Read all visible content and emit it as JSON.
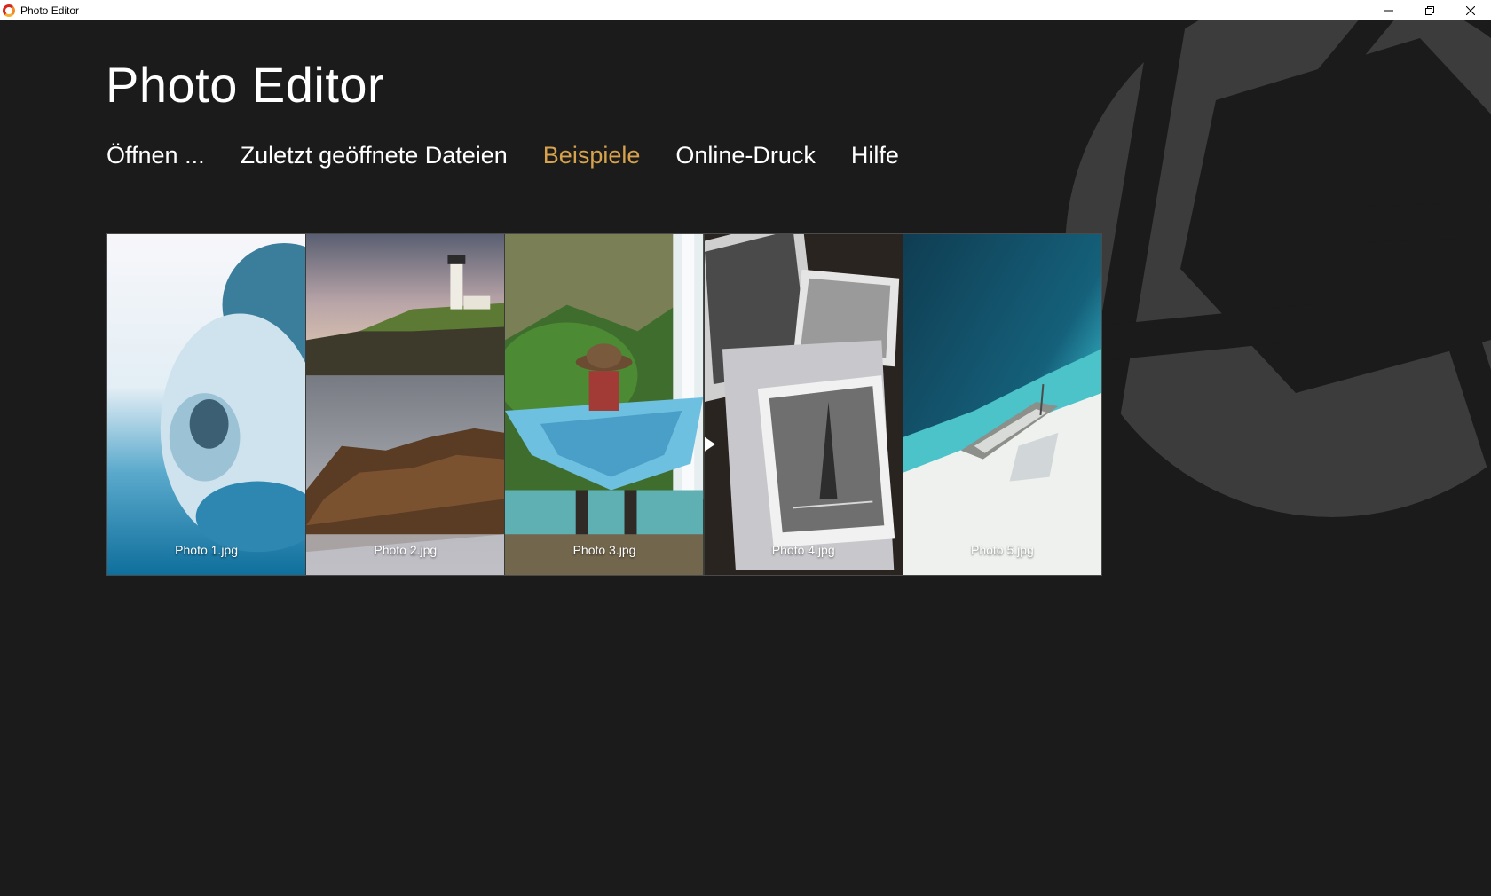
{
  "window": {
    "title": "Photo Editor",
    "controls": [
      "minimize-icon",
      "restore-icon",
      "close-icon"
    ]
  },
  "header": {
    "title": "Photo Editor"
  },
  "nav": {
    "items": [
      {
        "label": "Öffnen ...",
        "active": false
      },
      {
        "label": "Zuletzt geöffnete Dateien",
        "active": false
      },
      {
        "label": "Beispiele",
        "active": true
      },
      {
        "label": "Online-Druck",
        "active": false
      },
      {
        "label": "Hilfe",
        "active": false
      }
    ]
  },
  "gallery": {
    "photos": [
      {
        "label": "Photo 1.jpg"
      },
      {
        "label": "Photo 2.jpg"
      },
      {
        "label": "Photo 3.jpg"
      },
      {
        "label": "Photo 4.jpg"
      },
      {
        "label": "Photo 5.jpg"
      }
    ]
  },
  "colors": {
    "background": "#1b1b1c",
    "accent": "#d6a24c",
    "text": "#ffffff",
    "aperture": "#3c3c3d"
  }
}
